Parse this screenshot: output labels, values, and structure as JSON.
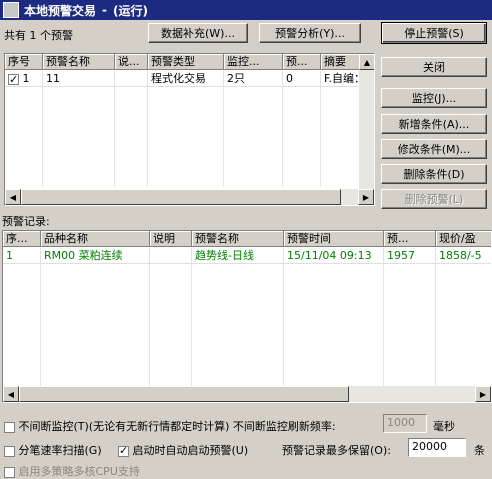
{
  "window": {
    "title": "本地预警交易",
    "separator": "-",
    "status": "(运行)"
  },
  "summary": {
    "count_text": "共有 1 个预警"
  },
  "toolbar": {
    "data_fill": "数据补充(W)...",
    "analysis": "预警分析(Y)...",
    "stop": "停止预警(S)"
  },
  "side_buttons": {
    "close": "关闭",
    "monitor": "监控(J)...",
    "add_condition": "新增条件(A)...",
    "edit_condition": "修改条件(M)...",
    "delete_condition": "删除条件(D)",
    "delete_alert": "删除预警(L)"
  },
  "alert_table": {
    "columns": [
      "序号",
      "预警名称",
      "说...",
      "预警类型",
      "监控...",
      "预...",
      "摘要"
    ],
    "rows": [
      {
        "index": "1",
        "checked": true,
        "name": "11",
        "desc": "",
        "type": "程式化交易",
        "monitor": "2只",
        "pre": "0",
        "summary": "F.自编："
      }
    ]
  },
  "records": {
    "label": "预警记录:",
    "columns": [
      "序...",
      "品种名称",
      "说明",
      "预警名称",
      "预警时间",
      "预...",
      "现价/盈"
    ],
    "rows": [
      {
        "index": "1",
        "product": "RM00 菜粕连续",
        "desc": "",
        "alert_name": "趋势线-日线",
        "time": "15/11/04 09:13",
        "pre": "1957",
        "price": "1858/-5"
      }
    ]
  },
  "options": {
    "continuous_label": "不间断监控(T)(无论有无新行情都定时计算) 不间断监控刷新频率:",
    "continuous_checked": false,
    "refresh_value": "1000",
    "refresh_unit": "毫秒",
    "tick_scan_label": "分笔速率扫描(G)",
    "tick_scan_checked": false,
    "auto_start_label": "启动时自动启动预警(U)",
    "auto_start_checked": true,
    "max_keep_label": "预警记录最多保留(O):",
    "max_keep_value": "20000",
    "max_keep_unit": "条",
    "multi_cpu_label": "启用多策略多核CPU支持"
  }
}
